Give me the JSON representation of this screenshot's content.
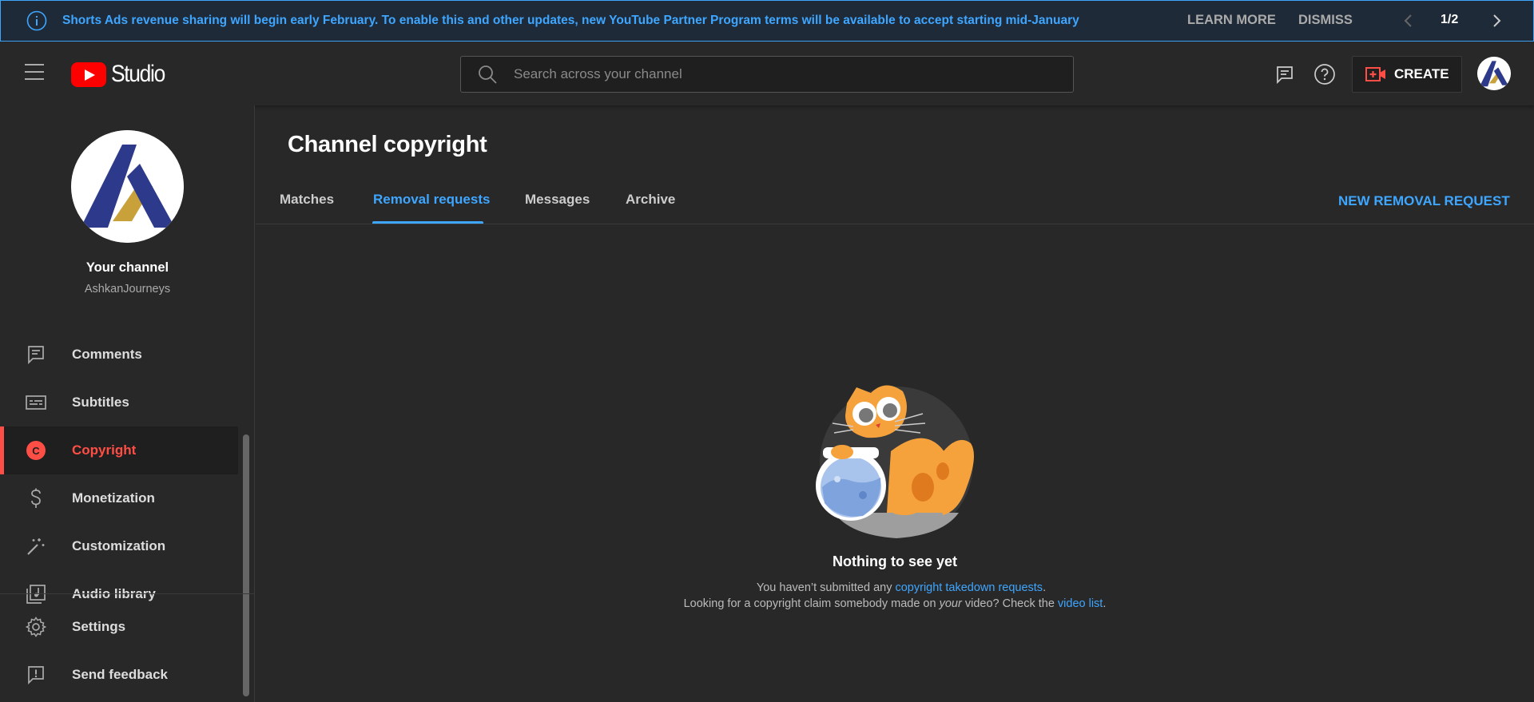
{
  "banner": {
    "message": "Shorts Ads revenue sharing will begin early February. To enable this and other updates, new YouTube Partner Program terms will be available to accept starting mid-January",
    "learn_more": "LEARN MORE",
    "dismiss": "DISMISS",
    "pager": "1/2",
    "accent": "#3ea6ff"
  },
  "header": {
    "logo_text": "Studio",
    "search_placeholder": "Search across your channel",
    "create_label": "CREATE"
  },
  "sidebar": {
    "channel_title": "Your channel",
    "channel_name": "AshkanJourneys",
    "items": [
      {
        "label": "Comments",
        "icon": "comments-icon"
      },
      {
        "label": "Subtitles",
        "icon": "subtitles-icon"
      },
      {
        "label": "Copyright",
        "icon": "copyright-icon",
        "active": true
      },
      {
        "label": "Monetization",
        "icon": "dollar-icon"
      },
      {
        "label": "Customization",
        "icon": "magic-wand-icon"
      },
      {
        "label": "Audio library",
        "icon": "audio-library-icon"
      },
      {
        "label": "Settings",
        "icon": "gear-icon"
      },
      {
        "label": "Send feedback",
        "icon": "feedback-icon"
      }
    ]
  },
  "main": {
    "title": "Channel copyright",
    "tabs": [
      {
        "label": "Matches"
      },
      {
        "label": "Removal requests",
        "active": true
      },
      {
        "label": "Messages"
      },
      {
        "label": "Archive"
      }
    ],
    "new_request": "NEW REMOVAL REQUEST",
    "empty": {
      "title": "Nothing to see yet",
      "line1_prefix": "You haven’t submitted any ",
      "line1_link": "copyright takedown requests",
      "line1_suffix": ".",
      "line2_prefix": "Looking for a copyright claim somebody made on ",
      "line2_em": "your",
      "line2_mid": " video? Check the ",
      "line2_link": "video list",
      "line2_suffix": "."
    }
  },
  "colors": {
    "active_red": "#ff4e45",
    "link_blue": "#3ea6ff",
    "bg": "#282828"
  }
}
